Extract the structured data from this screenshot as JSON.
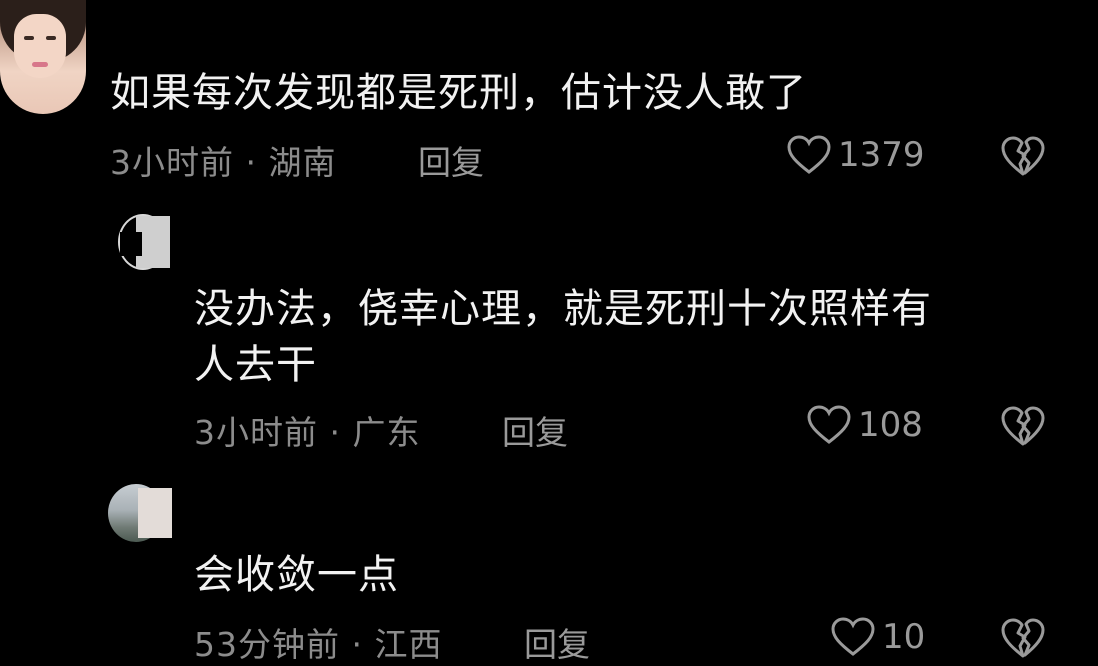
{
  "comments": [
    {
      "text": "如果每次发现都是死刑，估计没人敢了",
      "meta": "3小时前 · 湖南",
      "reply_label": "回复",
      "likes": "1379"
    },
    {
      "text_line1": "没办法，侥幸心理，就是死刑十次照样有",
      "text_line2": "人去干",
      "meta": "3小时前 · 广东",
      "reply_label": "回复",
      "likes": "108"
    },
    {
      "text": "会收敛一点",
      "meta": "53分钟前 · 江西",
      "reply_label": "回复",
      "likes": "10"
    }
  ],
  "icons": {
    "like": "heart-outline-icon",
    "dislike": "broken-heart-icon"
  },
  "colors": {
    "background": "#000000",
    "text": "#f2f2f2",
    "muted": "#8c8c8c"
  }
}
